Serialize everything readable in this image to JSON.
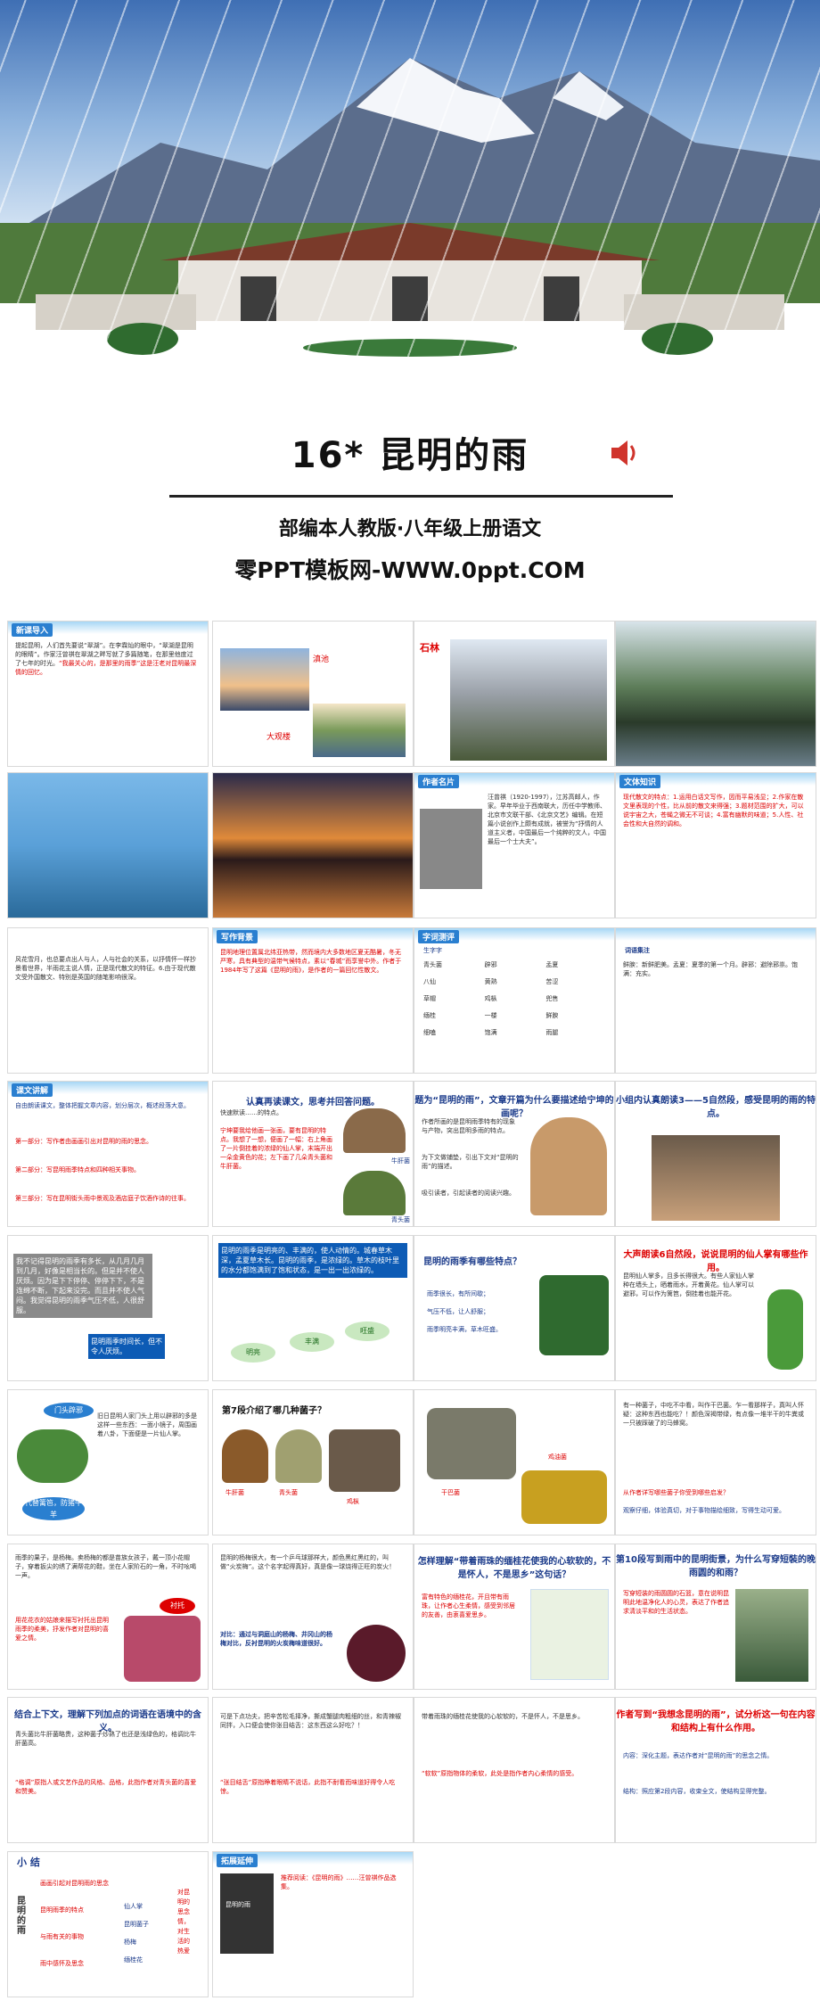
{
  "hero": {
    "title": "16*  昆明的雨",
    "subtitle": "部编本人教版·八年级上册语文",
    "site": "零PPT模板网-WWW.0ppt.COM"
  },
  "slides": {
    "s1": {
      "label": "新课导入",
      "text": "提起昆明，人们首先要说“翠湖”。在李霖灿的眼中，“翠湖是昆明的眼睛”。作家汪曾祺在翠湖之畔写就了多篇随笔，在那里他度过了七年的时光。",
      "red": "“我最关心的，是那里的雨季”这是汪老对昆明最深情的回忆。"
    },
    "s2": {
      "label1": "滇池",
      "label2": "大观楼"
    },
    "s3": {
      "label": "石林"
    },
    "s6": {
      "label": "作者名片",
      "text": "汪曾祺（1920-1997），江苏高邮人，作家。早年毕业于西南联大，历任中学教师、北京市文联干部、《北京文艺》编辑。在短篇小说创作上颇有成就，被誉为“抒情的人道主义者，中国最后一个纯粹的文人，中国最后一个士大夫”。"
    },
    "s7": {
      "label": "文体知识",
      "text": "现代散文的特点：1.运用白话文写作，因而平易浅显；2.作家在散文里表现的个性，比从前的散文来得强；3.题材范围的扩大，可以说宇宙之大，苍蝇之微无不可谈；4.富有幽默的味道；5.人性、社会性和大自然的调和。"
    },
    "s8": {
      "text": "风花雪月，也总要点出人与人，人与社会的关系，以抒情怀一样抄景看世界，半雨花主说人情，正是现代散文的特征。6.由于现代散文受外国散文、特别是英国的随笔影响很深。"
    },
    "s9": {
      "label": "写作背景",
      "text": "昆明地理位置属北纬亚热带，然而境内大多数地区夏无酷暑，冬无严寒，具有典型的温带气候特点，素以“春城”而享誉中外。作者于1984年写了这篇《昆明的雨》，是作者的一篇回忆性散文。"
    },
    "s10": {
      "label": "字词测评",
      "head": "生字字",
      "words": [
        "青头菌",
        "辟邪",
        "孟夏",
        "八仙",
        "黄熟",
        "苦涩",
        "草帽",
        "鸡枞",
        "兜售",
        "缅桂",
        "一楼",
        "鲜腴",
        "细嗑",
        "饱满",
        "雨腿"
      ]
    },
    "s11": {
      "head": "词语集注",
      "text": "鲜腴：新鲜肥美。孟夏：夏季的第一个月。辟邪：避除邪祟。饱满：充实。"
    },
    "s12": {
      "label": "课文讲解",
      "intro": "自由朗读课文，整体把握文章内容，划分层次，概述段落大意。",
      "p1": "第一部分：写作者由画画引出对昆明的雨的思念。",
      "p2": "第二部分：写昆明雨季特点和四种相关事物。",
      "p3": "第三部分：写在昆明街头雨中景观及酒店庭子饮酒作诗的往事。"
    },
    "s13": {
      "title": "认真再读课文，思考并回答问题。",
      "q": "快速默读……的特点。",
      "red": "宁坤要我给他画一张画，要有昆明的特点。我想了一想，便画了一幅：右上角画了一片倒挂着的浓绿的仙人掌，末端开出一朵金黄色的花；左下画了几朵青头菌和牛肝菌。",
      "side1": "牛肝菌",
      "side2": "青头菌"
    },
    "s14": {
      "title": "题为“昆明的雨”，文章开篇为什么要描述给宁坤的画呢？",
      "a1": "作者所画的是昆明雨季特有的现象与产物，突出昆明多雨的特点。",
      "a2": "为下文做铺垫，引出下文对“昆明的雨”的描述。",
      "a3": "吸引读者，引起读者的阅读兴趣。"
    },
    "s15": {
      "title": "小组内认真朗读3——5自然段，感受昆明的雨的特点。"
    },
    "s16": {
      "text": "我不记得昆明的雨季有多长，从几月几月到几月，好像是相当长的。但是并不使人厌烦。因为是下下停停、停停下下，不是连绵不断，下起来没完。而且并不使人气闷。我觉得昆明的雨季气压不低，人很舒服。",
      "tag": "昆明雨季时间长，但不令人厌烦。"
    },
    "s17": {
      "text": "昆明的雨季是明亮的、丰满的，使人动情的。城春草木深，孟夏草木长。昆明的雨季，是浓绿的。草木的枝叶里的水分都饱满到了饱和状态，是一出一出浓绿的。",
      "e1": "明亮",
      "e2": "丰满",
      "e3": "旺盛"
    },
    "s18": {
      "title": "昆明的雨季有哪些特点？",
      "b1": "雨季很长，有所间歇；",
      "b2": "气压不低，让人舒服；",
      "b3": "雨季明亮丰满，草木旺盛。"
    },
    "s19": {
      "title": "大声朗读6自然段，说说昆明的仙人掌有哪些作用。",
      "text": "昆明仙人掌多，且多长得很大。有些人家仙人掌种在墙头上，晒着雨水，开着黄花。仙人掌可以避邪，可以作为篱笆，倒挂着也能开花。"
    },
    "s20": {
      "bubble": "门头辟邪",
      "text": "旧日昆明人家门头上用以辟邪的多是这样一些东西：一面小镜子，周围画着八卦，下面便是一片仙人掌。",
      "bubble2": "代替篱笆，防猪牛羊"
    },
    "s21": {
      "title": "第7段介绍了哪几种菌子？",
      "m1": "牛肝菌",
      "m2": "青头菌",
      "m3": "鸡枞",
      "m4": "干巴菌",
      "m5": "鸡油菌"
    },
    "s22": {
      "text": "有一种菌子，中吃不中看，叫作干巴菌。乍一看那样子，真叫人怀疑：这种东西也能吃？！颜色深褐带绿，有点像一堆半干的牛粪或一只被踩破了的马蜂窝。",
      "red": "从作者详写哪些菌子你受到哪些启发？",
      "blue": "观察仔细，体验真切，对于事物描绘细致，写得生动可爱。"
    },
    "s23": {
      "text": "雨季的果子，是杨梅。卖杨梅的都是苗族女孩子，戴一顶小花帽子，穿着扳尖的绣了满帮花的鞋，坐在人家阶石的一角，不时吆喝一声。",
      "red": "用花花衣的姑娘来描写衬托出昆明雨季的柔美，抒发作者对昆明的喜爱之情。",
      "tag": "衬托"
    },
    "s24": {
      "text": "昆明的杨梅很大，有一个乒乓球那样大，颜色黑红黑红的，叫做“火炭梅”。这个名字起得真好，真是像一球烧得正旺的炭火！",
      "blue": "对比：通过与洞庭山的杨梅、井冈山的杨梅对比，反衬昆明的火炭梅味道很好。"
    },
    "s25": {
      "title": "怎样理解“带着雨珠的缅桂花使我的心软软的，不是怀人，不是思乡”这句话？",
      "red": "富有特色的缅桂花，开且带有雨珠，让作者心生柔情，感受到邻居的友善，由衷喜爱思乡。"
    },
    "s26": {
      "title": "第10段写到雨中的昆明街景，为什么写穿短裝的晚雨圆的和雨？",
      "text": "写穿短装的雨圆圆的石篮，意在说明昆明此地温净化人的心灵，表达了作者追求清淡平和的生活状态。"
    },
    "s27": {
      "title": "结合上下文，理解下列加点的词语在语境中的含义。",
      "text": "青头菌比牛肝菌略贵，这种菌子炒熟了也还是浅绿色的，格调比牛肝菌高。",
      "red": "“格调”原指人或文艺作品的风格、品格，此指作者对青头菌的喜爱和赞美。"
    },
    "s28": {
      "text": "可是下点功夫，把辛苦松毛择净，撕成蟹腿肉粗细的丝，和青辣椒同拌，入口便会使你张目结舌：这东西这么好吃？！",
      "red": "“张目结舌”原指睁着眼睛不说话，此指不耐看而味道好得令人吃惊。"
    },
    "s29": {
      "text": "带着雨珠的缅桂花使我的心软软的，不是怀人，不是思乡。",
      "red": "“软软”原指物体的柔软，此处是指作者内心柔情的感受。"
    },
    "s30": {
      "title": "作者写到“我想念昆明的雨”，试分析这一句在内容和结构上有什么作用。",
      "b1": "内容：深化主题，表达作者对“昆明的雨”的思念之情。",
      "b2": "结构：照应第2段内容，收束全文，使结构显得完整。"
    },
    "s31": {
      "label": "小 结",
      "main": "昆明的雨",
      "items": [
        "画画引起对昆明雨的思念",
        "昆明雨季的特点",
        "与雨有关的事物",
        "雨中感怀及思念"
      ],
      "sub": [
        "仙人掌",
        "昆明菌子",
        "杨梅",
        "缅桂花"
      ],
      "right": "对昆明的思念情，对生活的热爱"
    },
    "s32": {
      "label": "拓展延伸",
      "text": "推荐阅读：《昆明的雨》……汪曾祺作品选集。",
      "book": "昆明的雨"
    }
  }
}
